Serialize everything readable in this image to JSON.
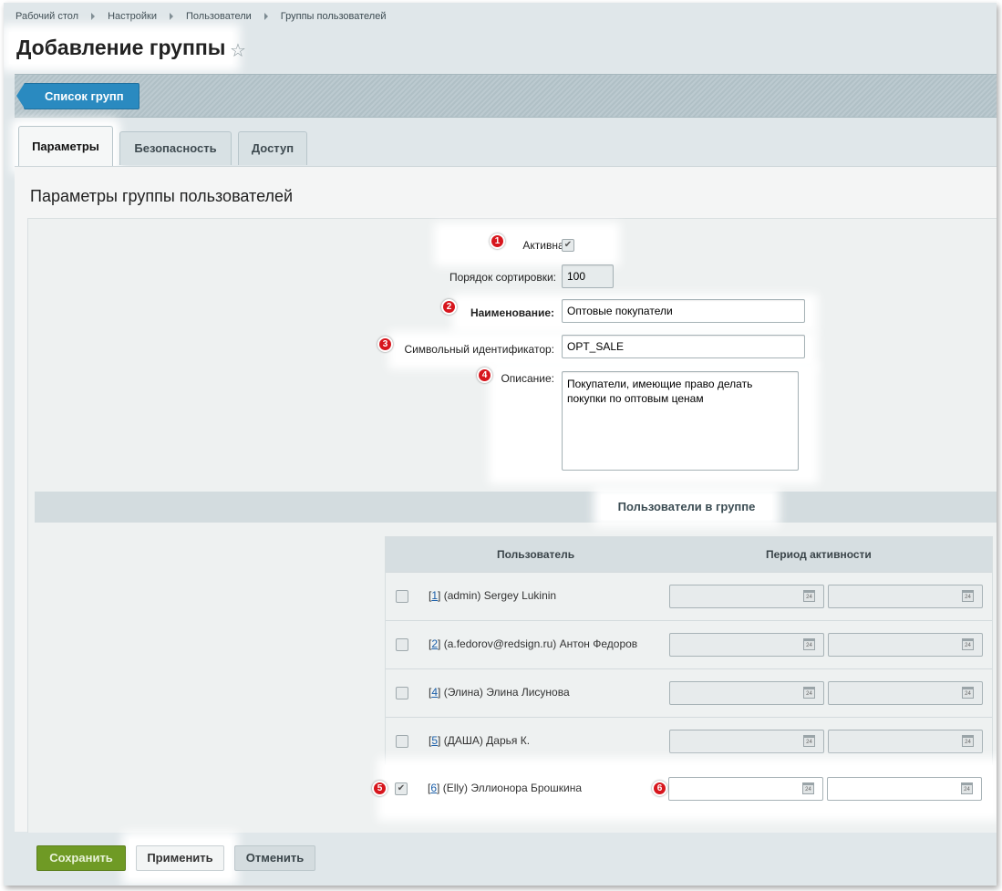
{
  "breadcrumb": [
    "Рабочий стол",
    "Настройки",
    "Пользователи",
    "Группы пользователей"
  ],
  "page_title": "Добавление группы",
  "toolbar": {
    "list_button": "Список групп"
  },
  "tabs": [
    {
      "label": "Параметры",
      "active": true
    },
    {
      "label": "Безопасность",
      "active": false
    },
    {
      "label": "Доступ",
      "active": false
    }
  ],
  "section_title": "Параметры группы пользователей",
  "form": {
    "active_label": "Активна:",
    "active_checked": true,
    "sort_label": "Порядок сортировки:",
    "sort_value": "100",
    "name_label": "Наименование:",
    "name_value": "Оптовые покупатели",
    "code_label": "Символьный идентификатор:",
    "code_value": "OPT_SALE",
    "desc_label": "Описание:",
    "desc_value": "Покупатели, имеющие право делать покупки по оптовым ценам"
  },
  "users_section_title": "Пользователи в группе",
  "users_table": {
    "col_user": "Пользователь",
    "col_period": "Период активности",
    "rows": [
      {
        "id": "1",
        "name": "(admin) Sergey Lukinin",
        "checked": false
      },
      {
        "id": "2",
        "name": "(a.fedorov@redsign.ru) Антон Федоров",
        "checked": false
      },
      {
        "id": "4",
        "name": "(Элина) Элина Лисунова",
        "checked": false
      },
      {
        "id": "5",
        "name": "(ДАША) Дарья К.",
        "checked": false
      },
      {
        "id": "6",
        "name": "(Elly) Эллионора Брошкина",
        "checked": true
      }
    ]
  },
  "badges": [
    "1",
    "2",
    "3",
    "4",
    "5",
    "6"
  ],
  "buttons": {
    "save": "Сохранить",
    "apply": "Применить",
    "cancel": "Отменить"
  },
  "colors": {
    "accent_blue": "#2a8ac0",
    "save_green": "#6f9a25",
    "badge_red": "#d7161d"
  }
}
